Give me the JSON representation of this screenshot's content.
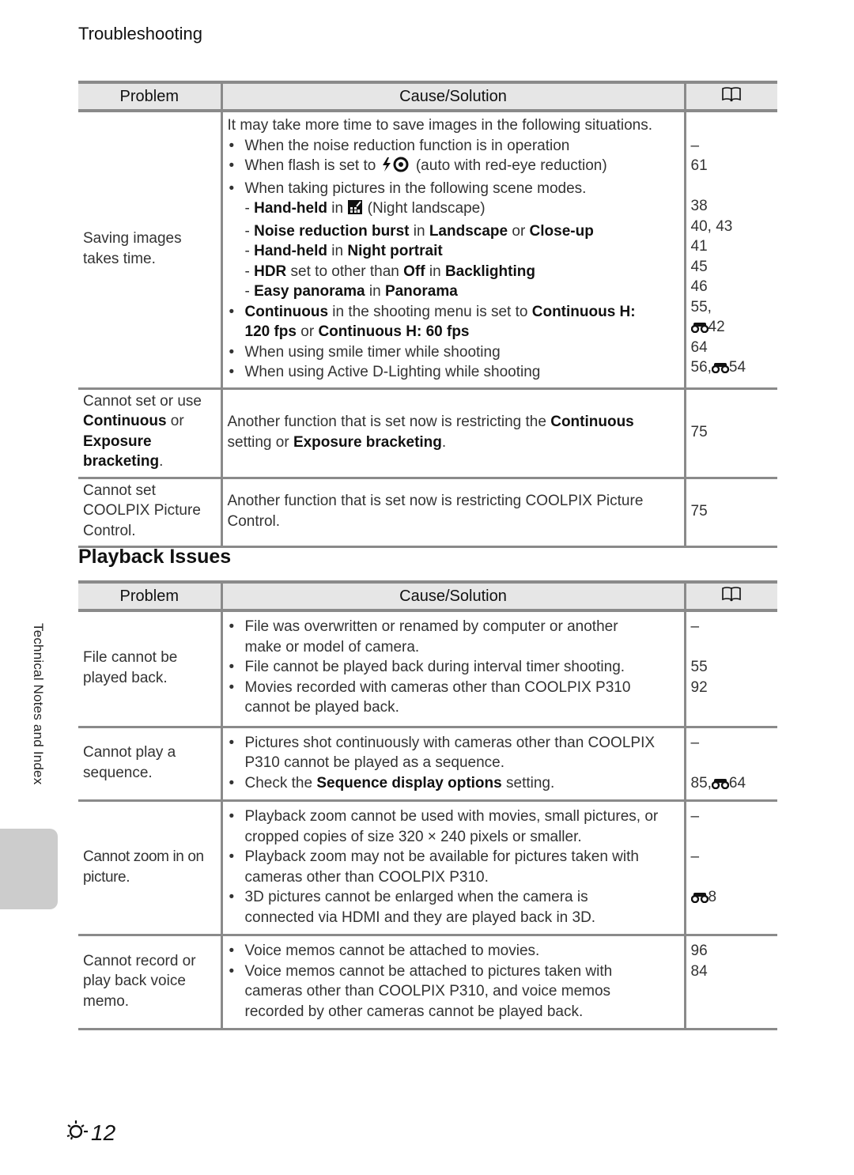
{
  "page": {
    "running_head": "Troubleshooting",
    "side_label": "Technical Notes and Index",
    "page_number": "12",
    "page_icon": "troubleshooting-sun-icon"
  },
  "table1": {
    "headers": {
      "problem": "Problem",
      "cause": "Cause/Solution",
      "ref_icon": "book-icon"
    },
    "rows": [
      {
        "problem": "Saving images takes time.",
        "intro": "It may take more time to save images in the following situations.",
        "items": [
          {
            "type": "bullet",
            "text": "When the noise reduction function is in operation",
            "ref": "–"
          },
          {
            "type": "bullet",
            "pre": "When flash is set to ",
            "icon": "flash-red-eye-icon",
            "post": " (auto with red-eye reduction)",
            "ref": "61"
          },
          {
            "type": "bullet",
            "text": "When taking pictures in the following scene modes.",
            "ref": ""
          },
          {
            "type": "sub",
            "b1": "Hand-held",
            "m1": " in ",
            "icon": "night-landscape-icon",
            "post": " (Night landscape)",
            "ref": "38"
          },
          {
            "type": "sub",
            "b1": "Noise reduction burst",
            "m1": " in ",
            "b2": "Landscape",
            "m2": " or ",
            "b3": "Close-up",
            "ref": "40, 43"
          },
          {
            "type": "sub",
            "b1": "Hand-held",
            "m1": " in ",
            "b2": "Night portrait",
            "ref": "41"
          },
          {
            "type": "sub",
            "b1": "HDR",
            "m1": " set to other than ",
            "b2": "Off",
            "m2": " in ",
            "b3": "Backlighting",
            "ref": "45"
          },
          {
            "type": "sub",
            "b1": "Easy panorama",
            "m1": " in ",
            "b2": "Panorama",
            "ref": "46"
          },
          {
            "type": "bullet",
            "b1": "Continuous",
            "m1": " in the shooting menu is set to ",
            "b2": "Continuous H:",
            "ref": "55,"
          },
          {
            "type": "cont",
            "b1": "120 fps",
            "m1": " or ",
            "b2": "Continuous H: 60 fps",
            "ref_icon": "reference-binoculars-icon",
            "ref": "42"
          },
          {
            "type": "bullet",
            "text": "When using smile timer while shooting",
            "ref": "64"
          },
          {
            "type": "bullet",
            "text": "When using Active D-Lighting while shooting",
            "ref_pre": "56,",
            "ref_icon": "reference-binoculars-icon",
            "ref": "54"
          }
        ]
      },
      {
        "problem_pre": "Cannot set or use",
        "problem_b1": "Continuous",
        "problem_m1": " or",
        "problem_b2": "Exposure bracketing",
        "problem_end": ".",
        "cause_pre": "Another function that is set now is restricting the ",
        "cause_b1": "Continuous",
        "cause_m1": " setting or ",
        "cause_b2": "Exposure bracketing",
        "cause_end": ".",
        "ref": "75"
      },
      {
        "problem": "Cannot set COOLPIX Picture Control.",
        "cause": "Another function that is set now is restricting COOLPIX Picture Control.",
        "ref": "75"
      }
    ]
  },
  "section_title": "Playback Issues",
  "table2": {
    "headers": {
      "problem": "Problem",
      "cause": "Cause/Solution",
      "ref_icon": "book-icon"
    },
    "rows": [
      {
        "problem": "File cannot be played back.",
        "items": [
          {
            "text1": "File was overwritten or renamed by computer or another",
            "text2": "make or model of camera.",
            "ref": "–"
          },
          {
            "text1": "File cannot be played back during interval timer shooting.",
            "ref": "55"
          },
          {
            "text1": "Movies recorded with cameras other than COOLPIX P310",
            "text2": "cannot be played back.",
            "ref": "92"
          }
        ]
      },
      {
        "problem": "Cannot play a sequence.",
        "items": [
          {
            "text1": "Pictures shot continuously with cameras other than COOLPIX",
            "text2": "P310 cannot be played as a sequence.",
            "ref": "–"
          },
          {
            "pre": "Check the ",
            "bold": "Sequence display options",
            "post": " setting.",
            "ref_pre": "85,",
            "ref_icon": "reference-binoculars-icon",
            "ref": "64"
          }
        ]
      },
      {
        "problem": "Cannot zoom in on picture.",
        "items": [
          {
            "text1": "Playback zoom cannot be used with movies, small pictures, or",
            "text2": "cropped copies of size 320 × 240 pixels or smaller.",
            "ref": "–"
          },
          {
            "text1": "Playback zoom may not be available for pictures taken with",
            "text2": "cameras other than COOLPIX P310.",
            "ref": "–"
          },
          {
            "text1": "3D pictures cannot be enlarged when the camera is",
            "text2": "connected via HDMI and they are played back in 3D.",
            "ref_icon": "reference-binoculars-icon",
            "ref": "8"
          }
        ]
      },
      {
        "problem": "Cannot record or play back voice memo.",
        "items": [
          {
            "text1": "Voice memos cannot be attached to movies.",
            "ref": "96"
          },
          {
            "text1": "Voice memos cannot be attached to pictures taken with",
            "text2": "cameras other than COOLPIX P310, and voice memos",
            "text3": "recorded by other cameras cannot be played back.",
            "ref": "84"
          }
        ]
      }
    ]
  }
}
